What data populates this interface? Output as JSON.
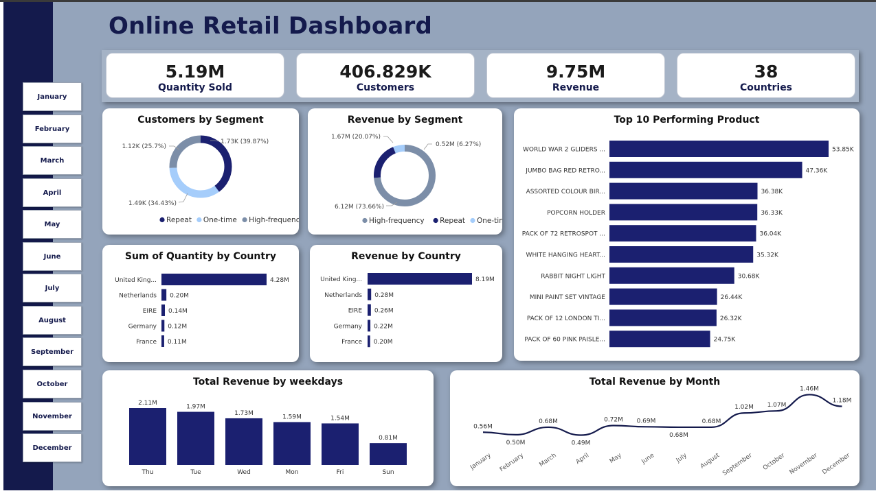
{
  "title": "Online Retail Dashboard",
  "months": [
    "January",
    "February",
    "March",
    "April",
    "May",
    "June",
    "July",
    "August",
    "September",
    "October",
    "November",
    "December"
  ],
  "kpis": [
    {
      "value": "5.19M",
      "label": "Quantity Sold"
    },
    {
      "value": "406.829K",
      "label": "Customers"
    },
    {
      "value": "9.75M",
      "label": "Revenue"
    },
    {
      "value": "38",
      "label": "Countries"
    }
  ],
  "colors": {
    "navy": "#1b2070",
    "light_blue": "#a5cdfb",
    "slate": "#7c8ea8",
    "background": "#94a4bb",
    "sidebar": "#141a4c"
  },
  "chart_data": [
    {
      "id": "customers_by_segment",
      "type": "pie",
      "title": "Customers by Segment",
      "slices": [
        {
          "name": "Repeat",
          "value": 1.73,
          "label": "1.73K (39.87%)",
          "color": "#1b2070"
        },
        {
          "name": "One-time",
          "value": 1.49,
          "label": "1.49K (34.43%)",
          "color": "#a5cdfb"
        },
        {
          "name": "High-frequency",
          "value": 1.12,
          "label": "1.12K (25.7%)",
          "color": "#7c8ea8"
        }
      ],
      "legend": [
        "Repeat",
        "One-time",
        "High-frequency"
      ],
      "legend_position": "bottom"
    },
    {
      "id": "revenue_by_segment",
      "type": "pie",
      "title": "Revenue by Segment",
      "slices": [
        {
          "name": "High-frequency",
          "value": 6.12,
          "label": "6.12M (73.66%)",
          "color": "#7c8ea8"
        },
        {
          "name": "Repeat",
          "value": 1.67,
          "label": "1.67M (20.07%)",
          "color": "#1b2070"
        },
        {
          "name": "One-time",
          "value": 0.52,
          "label": "0.52M (6.27%)",
          "color": "#a5cdfb"
        }
      ],
      "legend": [
        "High-frequency",
        "Repeat",
        "One-time"
      ],
      "legend_position": "bottom"
    },
    {
      "id": "top_products",
      "type": "bar",
      "orientation": "horizontal",
      "title": "Top 10 Performing Product",
      "categories": [
        "WORLD WAR 2 GLIDERS ...",
        "JUMBO BAG RED RETRO...",
        "ASSORTED COLOUR BIR...",
        "POPCORN HOLDER",
        "PACK OF 72 RETROSPOT ...",
        "WHITE HANGING HEART...",
        "RABBIT NIGHT LIGHT",
        "MINI PAINT SET VINTAGE",
        "PACK OF 12 LONDON TI...",
        "PACK OF 60 PINK PAISLE..."
      ],
      "values": [
        53.85,
        47.36,
        36.38,
        36.33,
        36.04,
        35.32,
        30.68,
        26.44,
        26.32,
        24.75
      ],
      "labels": [
        "53.85K",
        "47.36K",
        "36.38K",
        "36.33K",
        "36.04K",
        "35.32K",
        "30.68K",
        "26.44K",
        "26.32K",
        "24.75K"
      ]
    },
    {
      "id": "quantity_by_country",
      "type": "bar",
      "orientation": "horizontal",
      "title": "Sum of Quantity by Country",
      "categories": [
        "United King...",
        "Netherlands",
        "EIRE",
        "Germany",
        "France"
      ],
      "values": [
        4.28,
        0.2,
        0.14,
        0.12,
        0.11
      ],
      "labels": [
        "4.28M",
        "0.20M",
        "0.14M",
        "0.12M",
        "0.11M"
      ]
    },
    {
      "id": "revenue_by_country",
      "type": "bar",
      "orientation": "horizontal",
      "title": "Revenue by Country",
      "categories": [
        "United King...",
        "Netherlands",
        "EIRE",
        "Germany",
        "France"
      ],
      "values": [
        8.19,
        0.28,
        0.26,
        0.22,
        0.2
      ],
      "labels": [
        "8.19M",
        "0.28M",
        "0.26M",
        "0.22M",
        "0.20M"
      ]
    },
    {
      "id": "revenue_by_weekday",
      "type": "bar",
      "orientation": "vertical",
      "title": "Total Revenue by weekdays",
      "categories": [
        "Thu",
        "Tue",
        "Wed",
        "Mon",
        "Fri",
        "Sun"
      ],
      "values": [
        2.11,
        1.97,
        1.73,
        1.59,
        1.54,
        0.81
      ],
      "labels": [
        "2.11M",
        "1.97M",
        "1.73M",
        "1.59M",
        "1.54M",
        "0.81M"
      ]
    },
    {
      "id": "revenue_by_month",
      "type": "line",
      "title": "Total Revenue by Month",
      "categories": [
        "January",
        "February",
        "March",
        "April",
        "May",
        "June",
        "July",
        "August",
        "September",
        "October",
        "November",
        "December"
      ],
      "values": [
        0.56,
        0.5,
        0.68,
        0.49,
        0.72,
        0.69,
        0.68,
        0.68,
        1.02,
        1.07,
        1.46,
        1.18
      ],
      "labels": [
        "0.56M",
        "0.50M",
        "0.68M",
        "0.49M",
        "0.72M",
        "0.69M",
        "0.68M",
        "0.68M",
        "1.02M",
        "1.07M",
        "1.46M",
        "1.18M"
      ]
    }
  ]
}
